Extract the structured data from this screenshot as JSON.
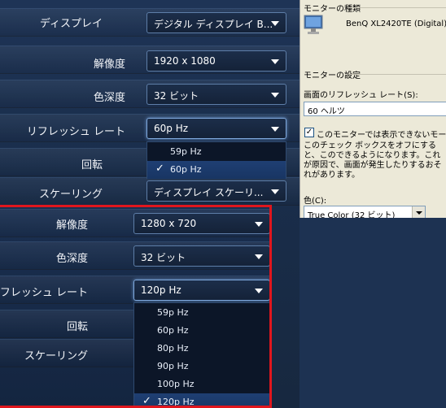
{
  "top_panel": {
    "display_label": "ディスプレイ",
    "display_value": "デジタル ディスプレイ B...",
    "resolution_label": "解像度",
    "resolution_value": "1920 x 1080",
    "color_depth_label": "色深度",
    "color_depth_value": "32 ビット",
    "refresh_label": "リフレッシュ レート",
    "refresh_value": "60p Hz",
    "refresh_options": [
      "59p Hz",
      "60p Hz"
    ],
    "refresh_selected": "60p Hz",
    "rotation_label": "回転",
    "scaling_label": "スケーリング",
    "scaling_value": "ディスプレイ スケーリ..."
  },
  "windows_panel": {
    "monitor_type_heading": "モニターの種類",
    "monitor_name": "BenQ XL2420TE (Digital)",
    "monitor_settings_heading": "モニターの設定",
    "refresh_rate_label": "画面のリフレッシュ レート(S):",
    "refresh_rate_value": "60 ヘルツ",
    "hide_modes_checkbox_label": "このモニターでは表示できないモード",
    "hide_modes_checked": true,
    "description_text": "このチェック ボックスをオフにすると、このできるようになります。これが原因で、画面が発生したりするおそれがあります。",
    "colors_label": "色(C):",
    "colors_value": "True Color (32 ビット)"
  },
  "bottom_panel": {
    "frame_color": "#e0161d",
    "resolution_label": "解像度",
    "resolution_value": "1280 x 720",
    "color_depth_label": "色深度",
    "color_depth_value": "32 ビット",
    "refresh_label": "リフレッシュ レート",
    "refresh_value": "120p Hz",
    "refresh_options": [
      "59p Hz",
      "60p Hz",
      "80p Hz",
      "90p Hz",
      "100p Hz",
      "120p Hz"
    ],
    "refresh_selected": "120p Hz",
    "rotation_label": "回転",
    "scaling_label": "スケーリング"
  },
  "icons": {
    "check": "check-icon",
    "monitor": "monitor-icon",
    "caret": "chevron-down-icon"
  }
}
